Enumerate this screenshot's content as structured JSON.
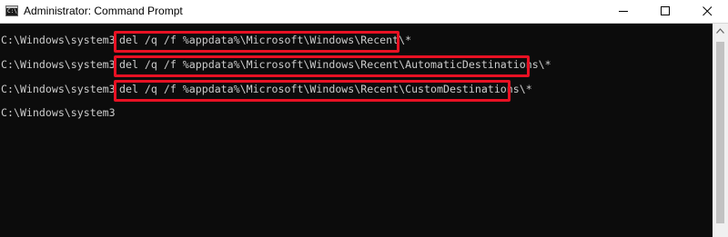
{
  "window": {
    "title": "Administrator: Command Prompt",
    "icon": "cmd-icon",
    "controls": {
      "minimize_icon": "minimize-icon",
      "maximize_icon": "maximize-icon",
      "close_icon": "close-icon"
    }
  },
  "console": {
    "background": "#0c0c0c",
    "text_color": "#cccccc",
    "highlight_color": "#e81123",
    "lines": [
      {
        "prompt": "C:\\Windows\\system32>",
        "command": "del /q /f %appdata%\\Microsoft\\Windows\\Recent\\*"
      },
      {
        "prompt": "C:\\Windows\\system32>",
        "command": "del /q /f %appdata%\\Microsoft\\Windows\\Recent\\AutomaticDestinations\\*"
      },
      {
        "prompt": "C:\\Windows\\system32>",
        "command": "del /q /f %appdata%\\Microsoft\\Windows\\Recent\\CustomDestinations\\*"
      },
      {
        "prompt": "C:\\Windows\\system32>",
        "command": ""
      }
    ]
  },
  "scrollbar": {
    "up_icon": "scroll-up-arrow-icon"
  }
}
